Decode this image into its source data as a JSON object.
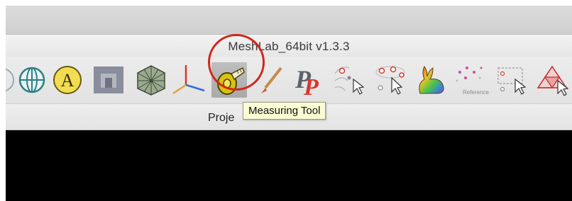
{
  "window": {
    "title": "MeshLab_64bit v1.3.3"
  },
  "toolbar": {
    "buttons": [
      {
        "name": "view-gizmo",
        "icon": "globe-icon"
      },
      {
        "name": "annotation",
        "icon": "letter-a-icon",
        "glyph": "A"
      },
      {
        "name": "texture",
        "icon": "building-icon"
      },
      {
        "name": "mesh-view",
        "icon": "mesh-icon"
      },
      {
        "name": "axes",
        "icon": "axes-icon"
      },
      {
        "name": "measuring-tool",
        "icon": "tape-measure-icon",
        "pressed": true
      },
      {
        "name": "paint",
        "icon": "brush-icon"
      },
      {
        "name": "pick-points",
        "icon": "pp-icon",
        "glyph": "P"
      },
      {
        "name": "select-points",
        "icon": "point-select-icon"
      },
      {
        "name": "select-faces",
        "icon": "face-select-icon"
      },
      {
        "name": "color-bunny",
        "icon": "bunny-icon"
      },
      {
        "name": "reference",
        "icon": "reference-icon",
        "label": "Reference"
      },
      {
        "name": "select-rect",
        "icon": "rect-select-icon"
      },
      {
        "name": "select-mesh",
        "icon": "mesh-select-icon"
      }
    ]
  },
  "menu": {
    "visible_label": "Proje"
  },
  "tooltip": {
    "text": "Measuring Tool"
  },
  "colors": {
    "annotation_circle": "#d2261c",
    "tooltip_bg": "#fbfbd5",
    "viewport": "#000000"
  }
}
